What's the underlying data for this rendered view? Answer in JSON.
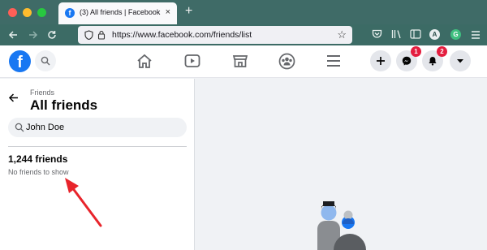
{
  "browser": {
    "tab_favicon": "f",
    "tab_title": "(3) All friends | Facebook",
    "tab_close": "×",
    "new_tab": "+",
    "url": "https://www.facebook.com/friends/list",
    "extension_a": "A",
    "extension_g": "G"
  },
  "header": {
    "logo": "f",
    "messenger_badge": "1",
    "notifications_badge": "2"
  },
  "sidebar": {
    "breadcrumb": "Friends",
    "title": "All friends",
    "search_value": "John Doe",
    "friend_count": "1,244 friends",
    "empty_message": "No friends to show"
  },
  "colors": {
    "brand": "#1877f2",
    "badge": "#e41e3f",
    "browser_chrome": "#3c6b65",
    "annotation_arrow": "#e8242b"
  }
}
